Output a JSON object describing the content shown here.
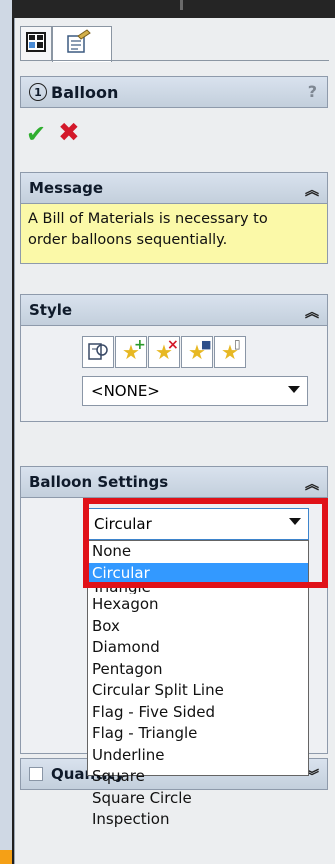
{
  "window": {
    "tabs": [
      "property-manager-tab",
      "configuration-tab"
    ]
  },
  "header": {
    "title": "Balloon",
    "number": "1",
    "help": "?"
  },
  "actions": {
    "ok": "✔",
    "cancel": "✖"
  },
  "message": {
    "title": "Message",
    "text_line1": "A Bill of Materials is necessary to",
    "text_line2": "order balloons sequentially."
  },
  "style": {
    "title": "Style",
    "buttons": [
      "load-style-icon",
      "add-style-icon",
      "delete-style-icon",
      "save-style-icon",
      "new-style-icon"
    ],
    "selected": "<NONE>"
  },
  "balloon_settings": {
    "title": "Balloon Settings",
    "selected": "Circular",
    "options": [
      "None",
      "Circular",
      "Triangle",
      "Hexagon",
      "Box",
      "Diamond",
      "Pentagon",
      "Circular Split Line",
      "Flag - Five Sided",
      "Flag - Triangle",
      "Underline",
      "Square",
      "Square Circle",
      "Inspection"
    ]
  },
  "quantity": {
    "title": "Quantity"
  },
  "colors": {
    "highlight": "#3399ff",
    "callout": "#e01118",
    "message_bg": "#fbf9a8",
    "ok": "#2fae2f",
    "cancel": "#d3182a"
  }
}
